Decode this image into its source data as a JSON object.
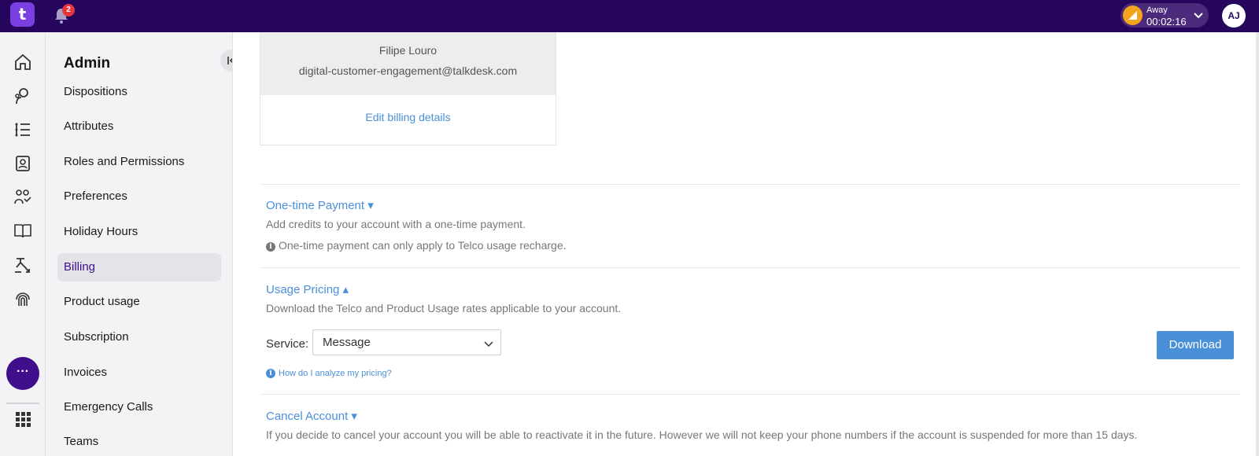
{
  "topbar": {
    "logo_text": "t",
    "notification_count": "2",
    "status_label": "Away",
    "status_timer": "00:02:16",
    "avatar_initials": "AJ"
  },
  "rail": {
    "icons": [
      "home-icon",
      "conversations-icon",
      "list-icon",
      "contacts-icon",
      "team-icon",
      "knowledge-book-icon",
      "workflow-icon",
      "fingerprint-icon",
      "more-icon",
      "apps-grid-icon"
    ],
    "more_label": "···"
  },
  "sidebar": {
    "title": "Admin",
    "items": [
      {
        "label": "Dispositions"
      },
      {
        "label": "Attributes"
      },
      {
        "label": "Roles and Permissions"
      },
      {
        "label": "Preferences"
      },
      {
        "label": "Holiday Hours"
      },
      {
        "label": "Billing",
        "active": true
      },
      {
        "label": "Product usage"
      },
      {
        "label": "Subscription"
      },
      {
        "label": "Invoices"
      },
      {
        "label": "Emergency Calls"
      },
      {
        "label": "Teams"
      }
    ]
  },
  "billing_card": {
    "name": "Filipe Louro",
    "email": "digital-customer-engagement@talkdesk.com",
    "edit_link": "Edit billing details"
  },
  "one_time_payment": {
    "title": "One-time Payment ▾",
    "description": "Add credits to your account with a one-time payment.",
    "note": "One-time payment can only apply to Telco usage recharge."
  },
  "usage_pricing": {
    "title": "Usage Pricing ▴",
    "description": "Download the Telco and Product Usage rates applicable to your account.",
    "service_label": "Service:",
    "service_value": "Message",
    "download_label": "Download",
    "help_link": "How do I analyze my pricing?"
  },
  "cancel_account": {
    "title": "Cancel Account ▾",
    "description": "If you decide to cancel your account you will be able to reactivate it in the future. However we will not keep your phone numbers if the account is suspended for more than 15 days."
  },
  "colors": {
    "topbar": "#26065d",
    "accent": "#3f0e8c",
    "link": "#4a90d9"
  }
}
